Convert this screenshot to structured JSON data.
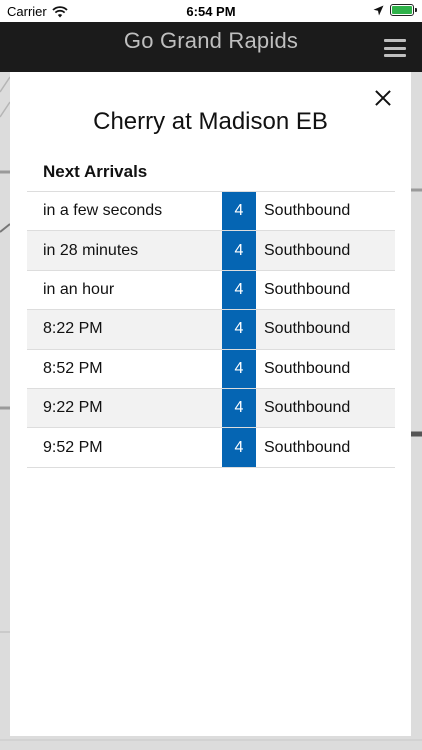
{
  "status_bar": {
    "carrier": "Carrier",
    "time": "6:54 PM"
  },
  "header": {
    "title": "Go Grand Rapids"
  },
  "modal": {
    "stop_name": "Cherry at Madison EB",
    "section_heading": "Next Arrivals",
    "arrivals": [
      {
        "when": "in a few seconds",
        "route": "4",
        "direction": "Southbound"
      },
      {
        "when": "in 28 minutes",
        "route": "4",
        "direction": "Southbound"
      },
      {
        "when": "in an hour",
        "route": "4",
        "direction": "Southbound"
      },
      {
        "when": "8:22 PM",
        "route": "4",
        "direction": "Southbound"
      },
      {
        "when": "8:52 PM",
        "route": "4",
        "direction": "Southbound"
      },
      {
        "when": "9:22 PM",
        "route": "4",
        "direction": "Southbound"
      },
      {
        "when": "9:52 PM",
        "route": "4",
        "direction": "Southbound"
      }
    ]
  },
  "colors": {
    "route_badge": "#0565b3",
    "header_bg": "#1b1b1b",
    "battery": "#2fb24a"
  }
}
